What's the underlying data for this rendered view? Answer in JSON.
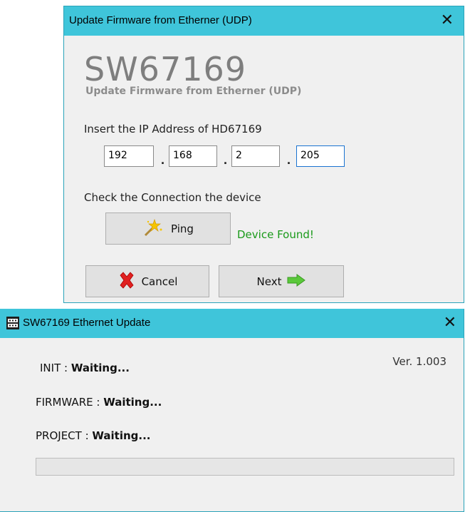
{
  "update_dialog": {
    "title": "Update Firmware from Etherner (UDP)",
    "close_glyph": "✕",
    "product": "SW67169",
    "subtitle": "Update Firmware from Etherner (UDP)",
    "ip_prompt": "Insert the IP Address of HD67169",
    "ip": [
      "192",
      "168",
      "2",
      "205"
    ],
    "ip_separator": ".",
    "check_prompt": "Check the Connection the device",
    "ping_label": "Ping",
    "ping_result": "Device Found!",
    "cancel_label": "Cancel",
    "next_label": "Next",
    "accent_color": "#3fc5da",
    "success_color": "#1a9a1a"
  },
  "ethernet_update": {
    "title": "SW67169 Ethernet Update",
    "close_glyph": "✕",
    "version": "Ver. 1.003",
    "init_label": "INIT : ",
    "init_status": "Waiting...",
    "firmware_label": "FIRMWARE : ",
    "firmware_status": "Waiting...",
    "project_label": "PROJECT : ",
    "project_status": "Waiting...",
    "progress_fraction": 0
  }
}
